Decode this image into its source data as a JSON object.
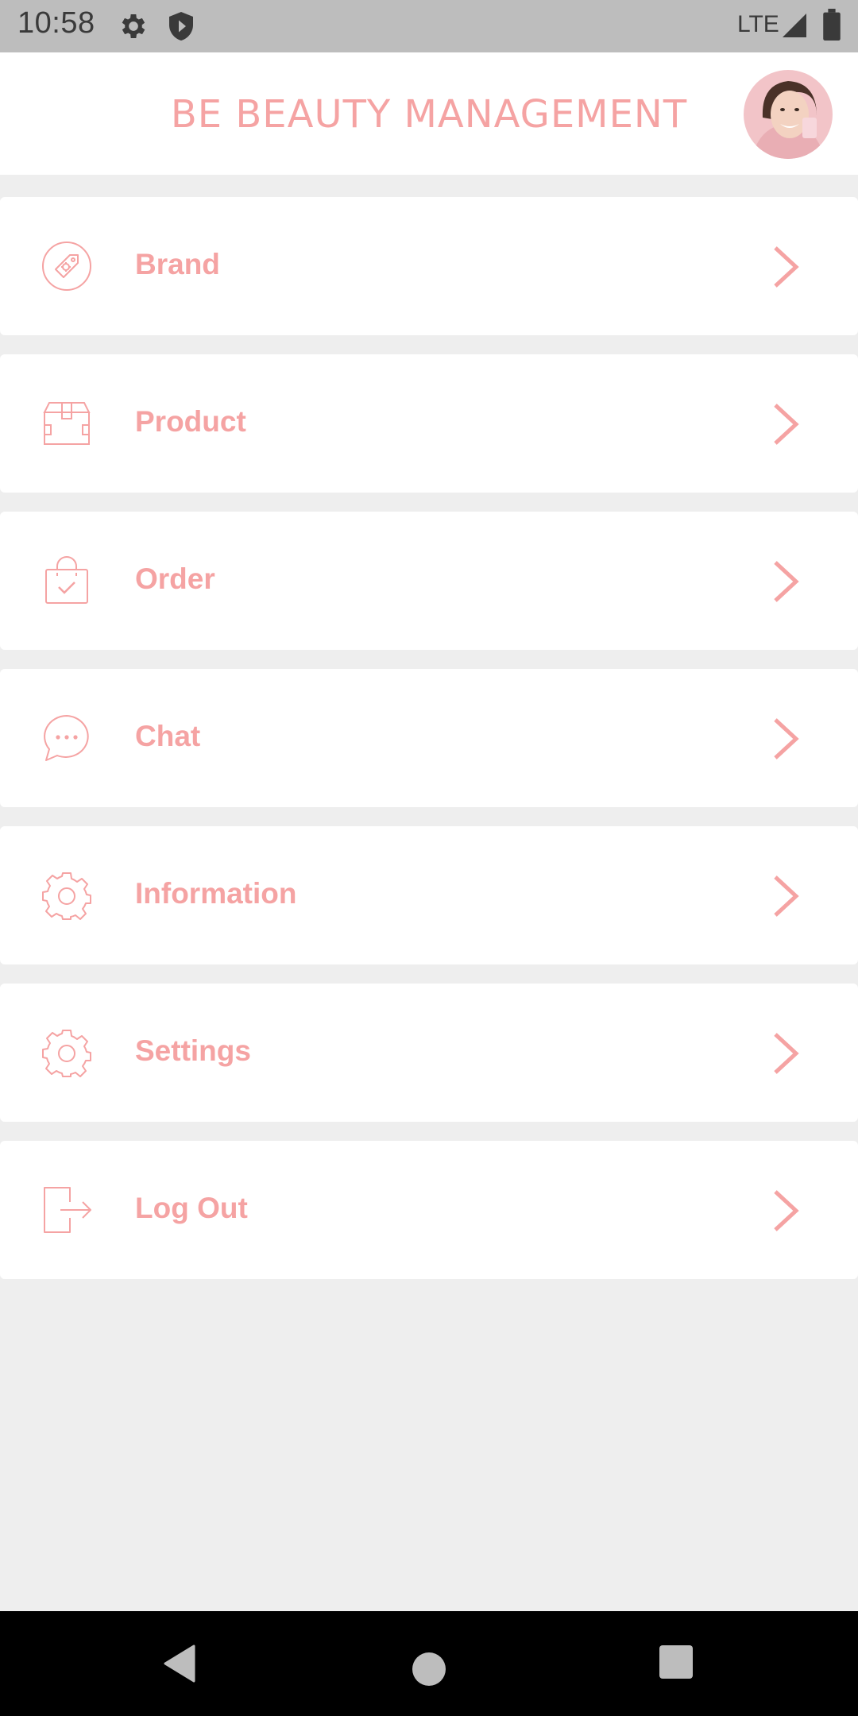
{
  "status_bar": {
    "time": "10:58",
    "network": "LTE"
  },
  "header": {
    "title": "BE BEAUTY MANAGEMENT"
  },
  "menu": {
    "items": [
      {
        "label": "Brand",
        "icon": "tag-icon"
      },
      {
        "label": "Product",
        "icon": "box-icon"
      },
      {
        "label": "Order",
        "icon": "shopping-bag-icon"
      },
      {
        "label": "Chat",
        "icon": "chat-bubble-icon"
      },
      {
        "label": "Information",
        "icon": "gear-icon"
      },
      {
        "label": "Settings",
        "icon": "gear-icon"
      },
      {
        "label": "Log Out",
        "icon": "logout-icon"
      }
    ]
  },
  "colors": {
    "accent": "#f5a3a3",
    "background": "#eeeeee",
    "card": "#ffffff",
    "status_bar": "#bdbdbd",
    "nav_bar": "#000000"
  }
}
